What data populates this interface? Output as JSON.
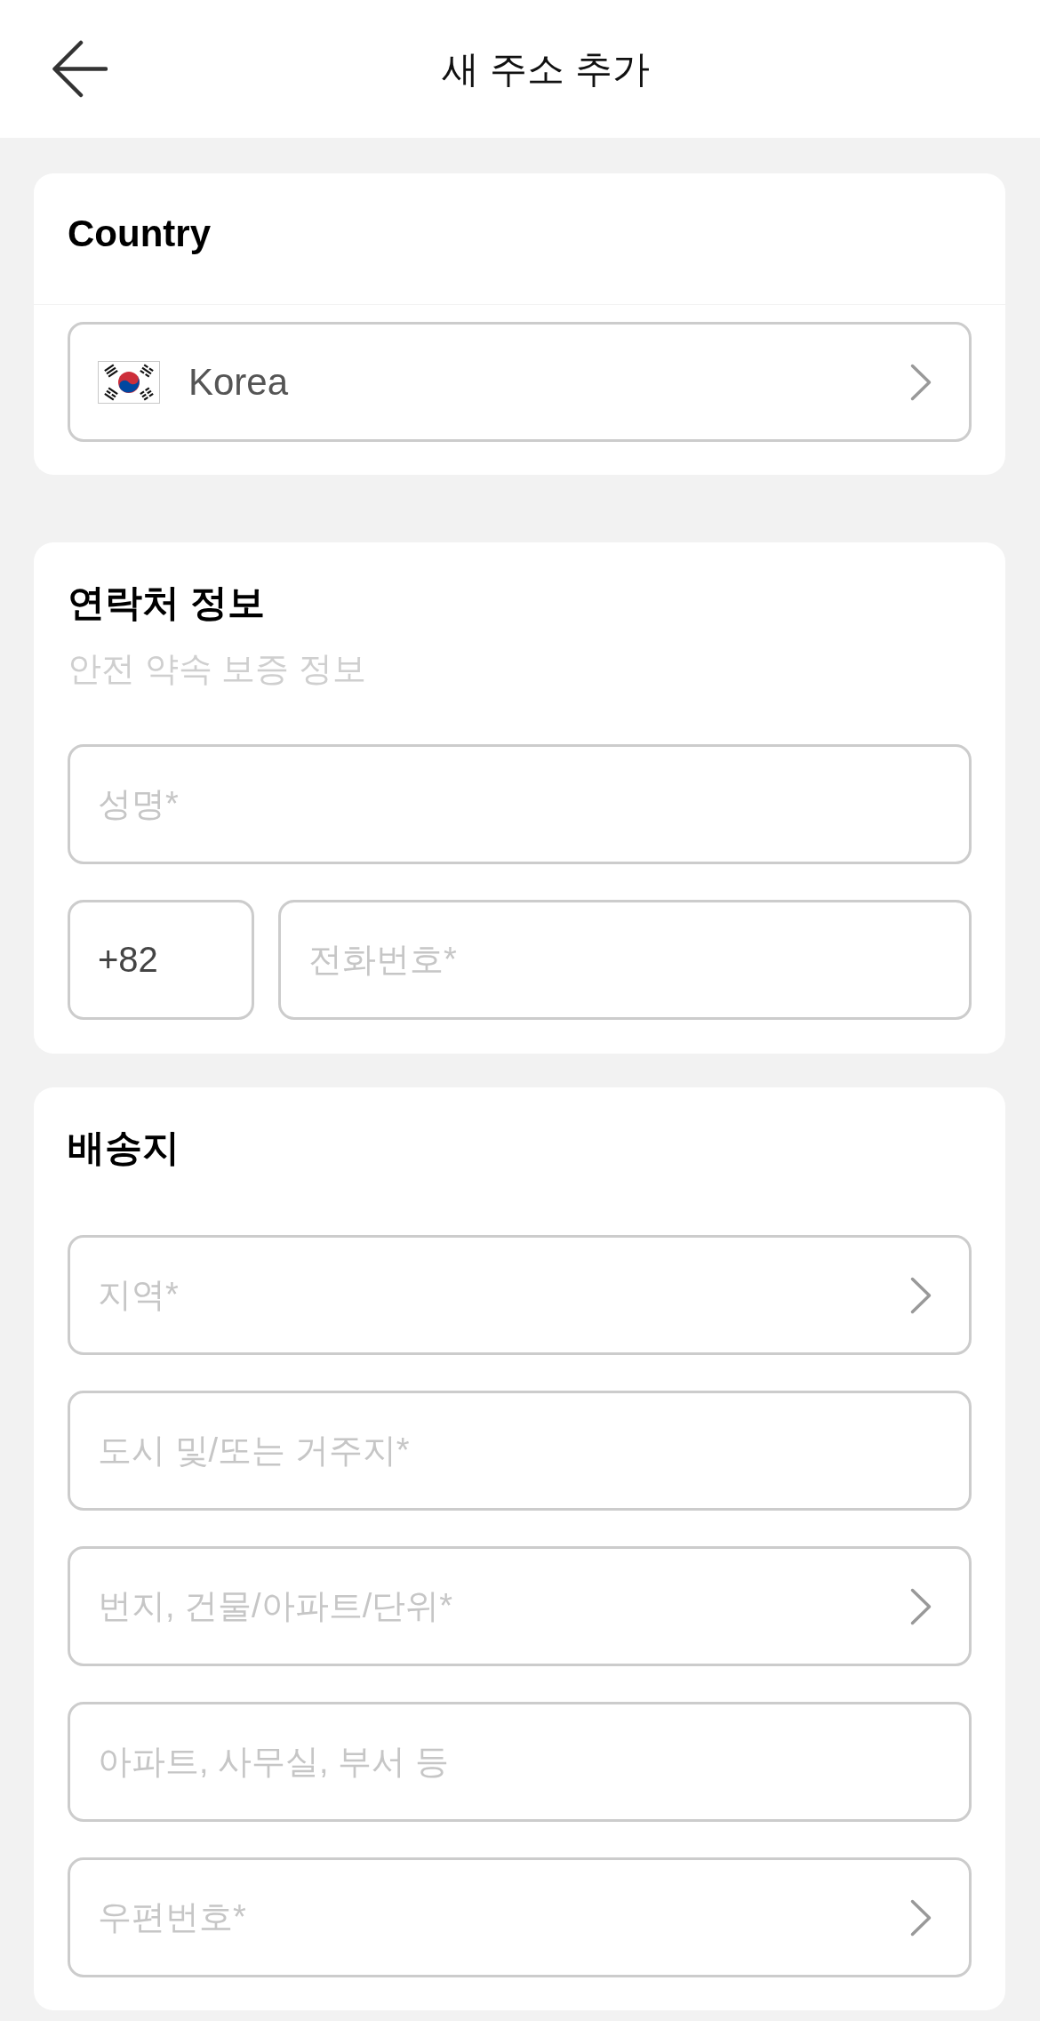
{
  "header": {
    "title": "새 주소 추가"
  },
  "country_section": {
    "title": "Country",
    "selector": {
      "value": "Korea"
    }
  },
  "contact_section": {
    "title": "연락처 정보",
    "subtitle": "안전 약속 보증 정보",
    "name_field": {
      "placeholder": "성명*"
    },
    "phone_code": {
      "value": "+82"
    },
    "phone_field": {
      "placeholder": "전화번호*"
    }
  },
  "shipping_section": {
    "title": "배송지",
    "fields": [
      {
        "kind": "select",
        "placeholder": "지역*"
      },
      {
        "kind": "text",
        "placeholder": "도시 및/또는 거주지*"
      },
      {
        "kind": "select",
        "placeholder": "번지, 건물/아파트/단위*"
      },
      {
        "kind": "text",
        "placeholder": "아파트, 사무실, 부서 등"
      },
      {
        "kind": "select",
        "placeholder": "우편번호*"
      }
    ]
  }
}
